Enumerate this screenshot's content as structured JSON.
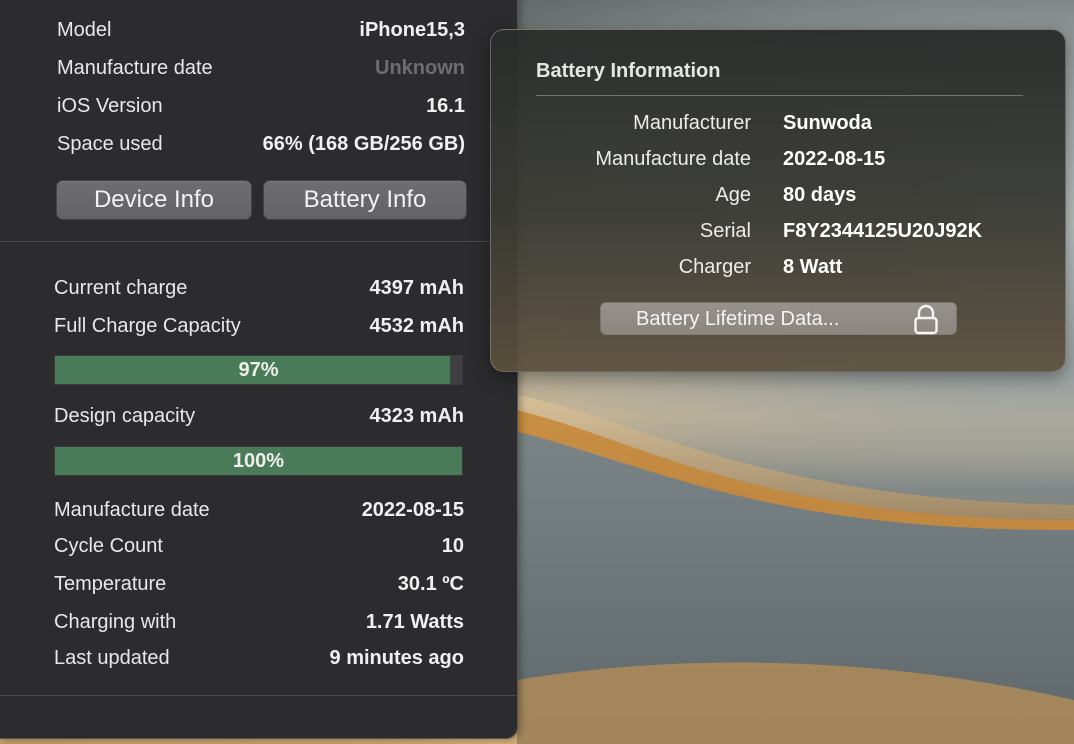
{
  "device": {
    "rows": [
      {
        "label": "Model",
        "value": "iPhone15,3",
        "dim": false
      },
      {
        "label": "Manufacture date",
        "value": "Unknown",
        "dim": true
      },
      {
        "label": "iOS Version",
        "value": "16.1",
        "dim": false
      },
      {
        "label": "Space used",
        "value": "66% (168 GB/256 GB)",
        "dim": false
      }
    ]
  },
  "buttons": {
    "device_info": "Device Info",
    "battery_info": "Battery Info"
  },
  "battery": {
    "current_charge": {
      "label": "Current charge",
      "value": "4397 mAh"
    },
    "full_charge": {
      "label": "Full Charge Capacity",
      "value": "4532 mAh"
    },
    "full_charge_bar": {
      "percent": 97,
      "label": "97%"
    },
    "design_capacity": {
      "label": "Design capacity",
      "value": "4323 mAh"
    },
    "design_bar": {
      "percent": 100,
      "label": "100%"
    },
    "details": [
      {
        "label": "Manufacture date",
        "value": "2022-08-15"
      },
      {
        "label": "Cycle Count",
        "value": "10"
      },
      {
        "label": "Temperature",
        "value": "30.1 ºC"
      },
      {
        "label": "Charging with",
        "value": "1.71 Watts"
      },
      {
        "label": "Last updated",
        "value": "9 minutes ago"
      }
    ]
  },
  "popover": {
    "title": "Battery Information",
    "rows": [
      {
        "label": "Manufacturer",
        "value": "Sunwoda"
      },
      {
        "label": "Manufacture date",
        "value": "2022-08-15"
      },
      {
        "label": "Age",
        "value": "80 days"
      },
      {
        "label": "Serial",
        "value": "F8Y2344125U20J92K"
      },
      {
        "label": "Charger",
        "value": "8 Watt"
      }
    ],
    "lifetime_button": "Battery Lifetime Data...",
    "lock_icon": "lock-icon"
  },
  "colors": {
    "panel_bg": "#2c2c2e",
    "bar_fill": "#4a7b58",
    "bar_track": "#3f3f41",
    "dim_text": "#6e6e70"
  }
}
